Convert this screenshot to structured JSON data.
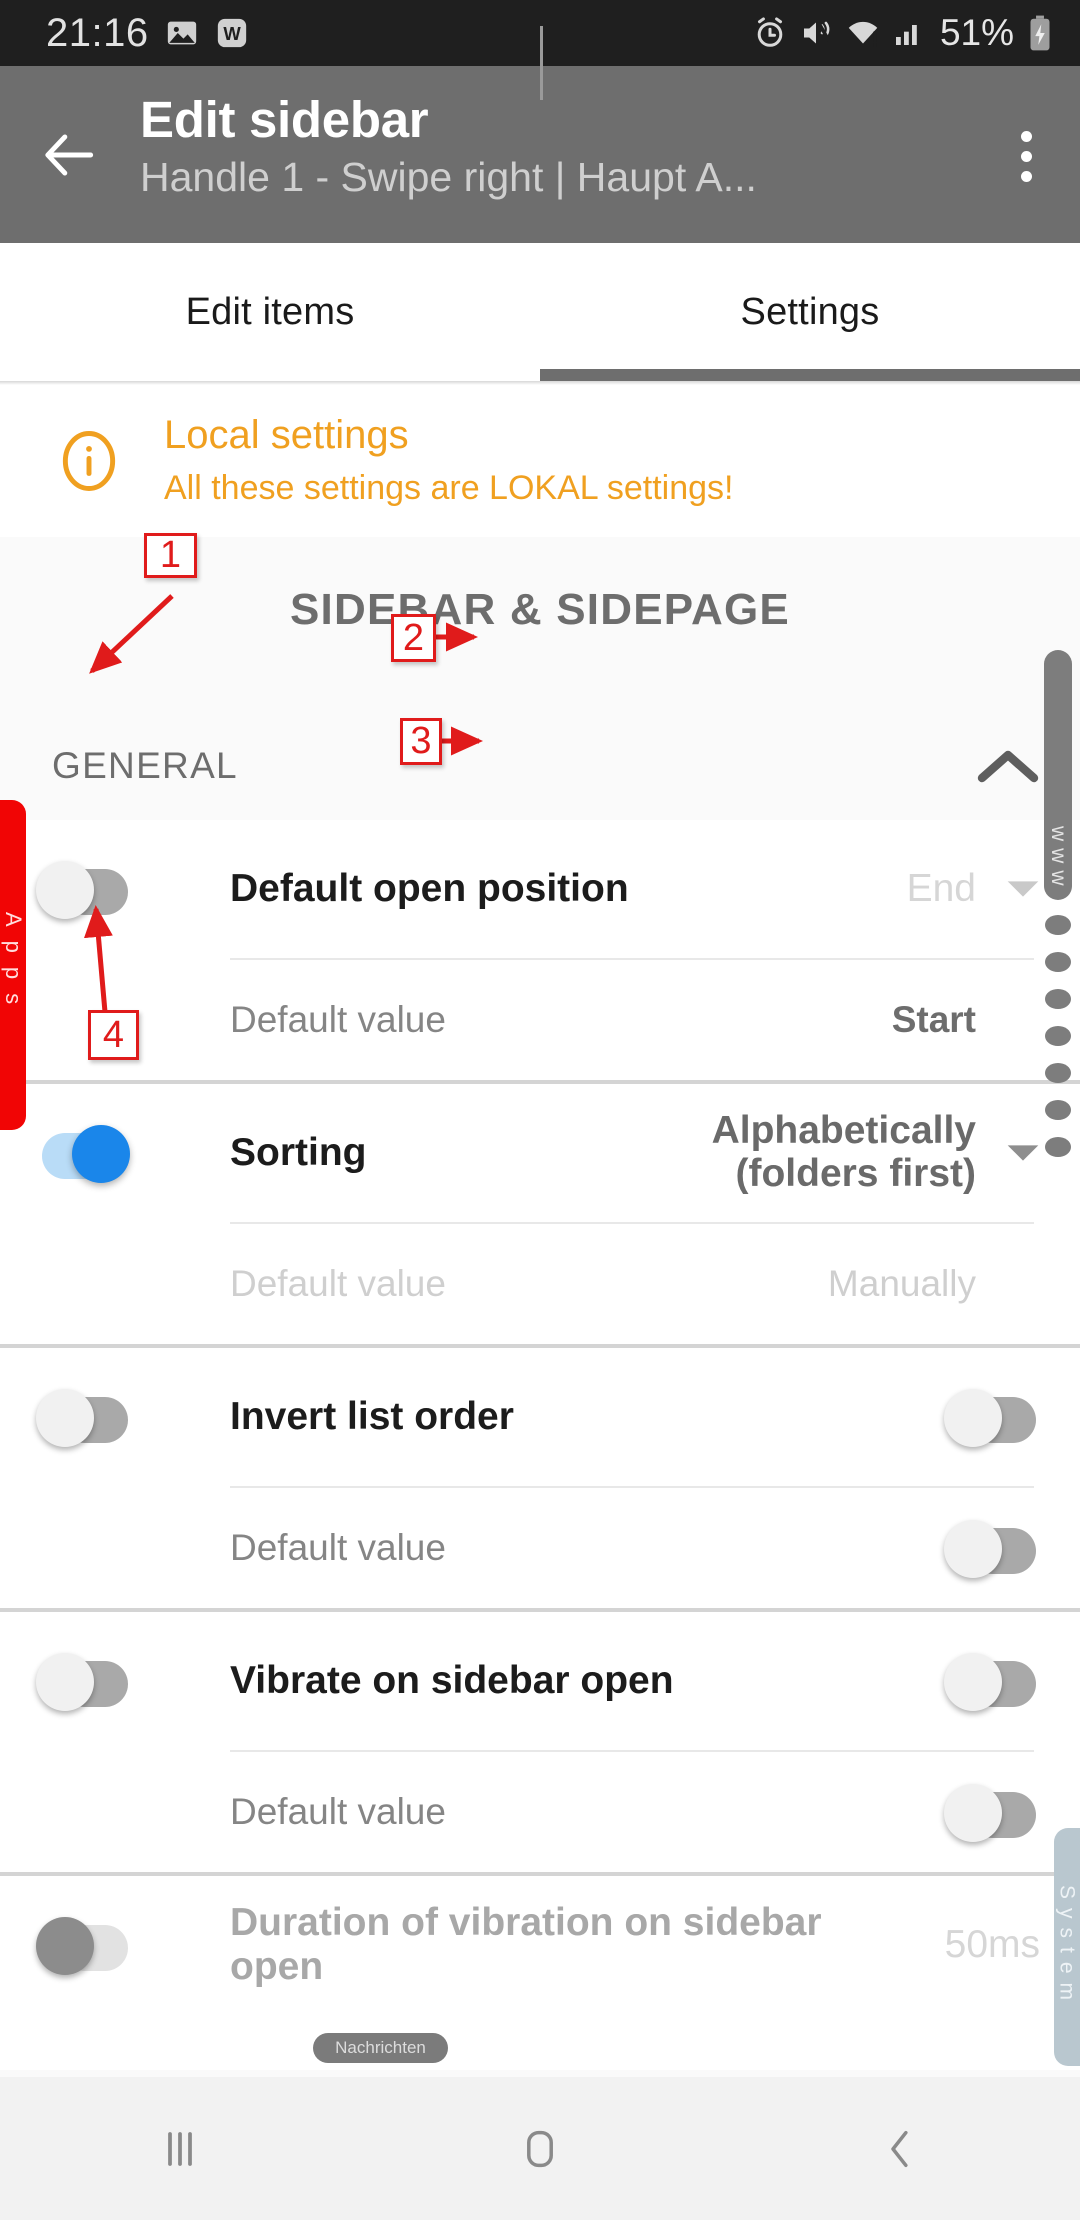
{
  "statusbar": {
    "clock": "21:16",
    "icons_left": [
      "image-icon",
      "w-app-icon"
    ],
    "icons_right": [
      "alarm-icon",
      "mute-vibrate-icon",
      "wifi-warning-icon",
      "signal-icon"
    ],
    "battery_percent": "51%",
    "battery_state": "charging"
  },
  "appbar": {
    "back_icon": "back-arrow-icon",
    "title": "Edit sidebar",
    "subtitle": "Handle 1 - Swipe right | Haupt A...",
    "overflow_icon": "more-vertical-icon"
  },
  "tabs": {
    "items": [
      {
        "label": "Edit items",
        "active": false
      },
      {
        "label": "Settings",
        "active": true
      }
    ]
  },
  "banner": {
    "icon": "info-circle-icon",
    "title": "Local settings",
    "subtitle": "All these settings are LOKAL settings!",
    "color": "#f0a020"
  },
  "page": {
    "heading": "SIDEBAR & SIDEPAGE",
    "section": {
      "title": "GENERAL",
      "collapse_icon": "chevron-up-icon"
    }
  },
  "settings": [
    {
      "title": "Default open position",
      "value": "End",
      "value_muted": true,
      "has_dropdown": true,
      "left_toggle": "off",
      "sub_label": "Default value",
      "sub_value": "Start",
      "sub_value_muted": false,
      "sub_toggle": null
    },
    {
      "title": "Sorting",
      "value": "Alphabetically (folders first)",
      "value_muted": false,
      "has_dropdown": true,
      "left_toggle": "on",
      "sub_label": "Default value",
      "sub_value": "Manually",
      "sub_value_muted": true,
      "sub_toggle": null
    },
    {
      "title": "Invert list order",
      "value": "",
      "value_muted": false,
      "has_dropdown": false,
      "left_toggle": "off",
      "sub_label": "Default value",
      "sub_value": "",
      "sub_value_muted": false,
      "sub_toggle": "off"
    },
    {
      "title": "Vibrate on sidebar open",
      "value": "",
      "value_muted": false,
      "has_dropdown": false,
      "left_toggle": "off",
      "sub_label": "Default value",
      "sub_value": "",
      "sub_value_muted": false,
      "sub_toggle": "off"
    },
    {
      "title": "Duration of vibration on sidebar open",
      "title_muted": true,
      "value": "50ms",
      "value_muted": true,
      "has_dropdown": false,
      "left_toggle": "dim",
      "sub_label": "",
      "sub_value": "",
      "sub_toggle": null
    }
  ],
  "edge_handles": {
    "left_label": "Apps",
    "left_color": "#f10505",
    "right_label": "System",
    "right_color": "#b9c7cf",
    "scroll_label": "www"
  },
  "toast": {
    "label": "Nachrichten"
  },
  "navbar": {
    "recents_icon": "recents-icon",
    "home_icon": "home-icon",
    "back_icon": "back-chevron-icon"
  },
  "annotations": [
    {
      "id": "1",
      "label": "1"
    },
    {
      "id": "2",
      "label": "2"
    },
    {
      "id": "3",
      "label": "3"
    },
    {
      "id": "4",
      "label": "4"
    }
  ]
}
